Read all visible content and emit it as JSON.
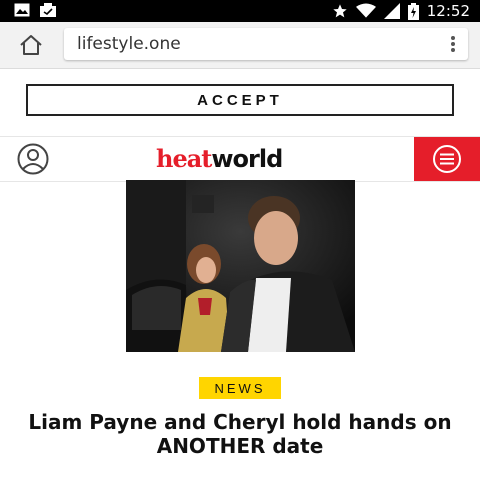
{
  "status_bar": {
    "time": "12:52",
    "icons": [
      "gallery-icon",
      "notification-icon",
      "star-icon",
      "wifi-icon",
      "signal-icon",
      "battery-icon"
    ]
  },
  "browser": {
    "url": "lifestyle.one",
    "home_icon": "home-icon",
    "menu_icon": "kebab-menu-icon"
  },
  "cookie_banner": {
    "accept_label": "ACCEPT"
  },
  "site_header": {
    "logo_part1": "heat",
    "logo_part2": "world",
    "user_icon": "user-icon",
    "menu_icon": "hamburger-menu-icon",
    "brand_color": "#e51e2a"
  },
  "article": {
    "image_alt": "Photo of Liam Payne and Cheryl at night",
    "category": "NEWS",
    "category_color": "#ffd500",
    "headline": "Liam Payne and Cheryl hold hands on ANOTHER date"
  }
}
